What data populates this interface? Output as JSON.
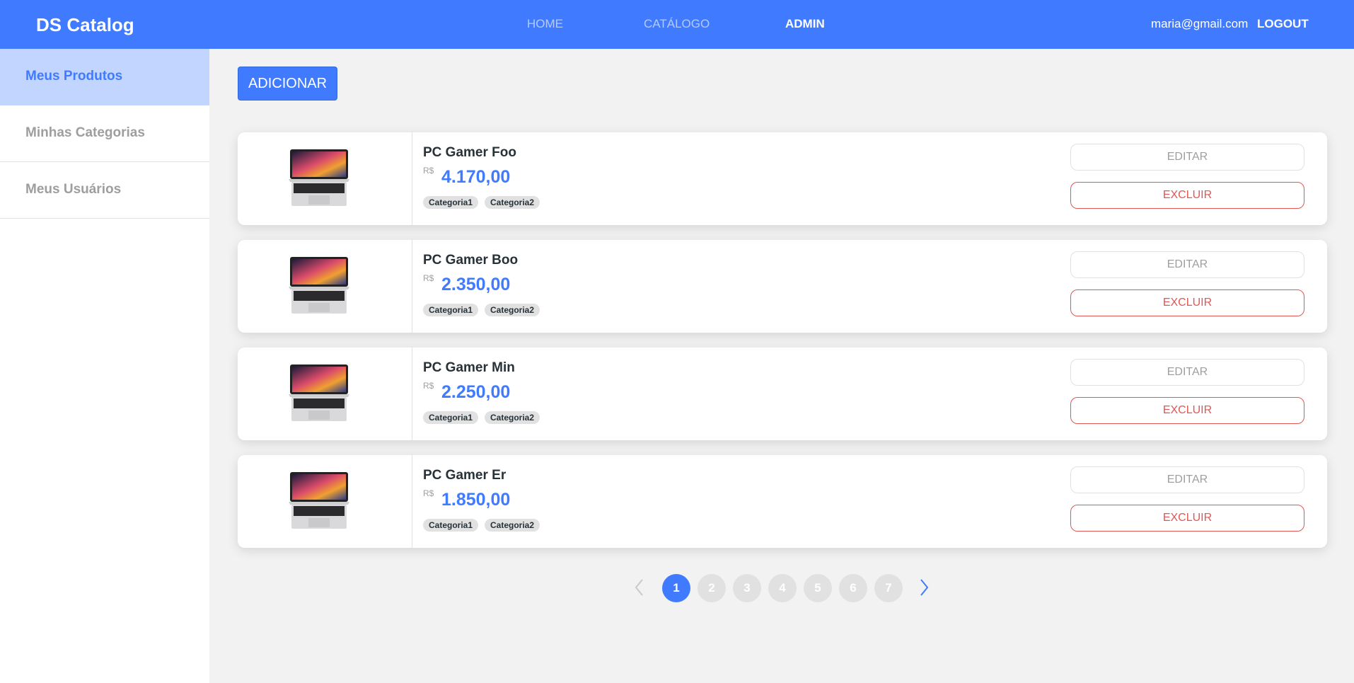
{
  "navbar": {
    "brand": "DS Catalog",
    "links": [
      {
        "label": "HOME",
        "active": false
      },
      {
        "label": "CATÁLOGO",
        "active": false
      },
      {
        "label": "ADMIN",
        "active": true
      }
    ],
    "user_email": "maria@gmail.com",
    "logout_label": "LOGOUT"
  },
  "sidebar": {
    "items": [
      {
        "label": "Meus Produtos",
        "active": true
      },
      {
        "label": "Minhas Categorias",
        "active": false
      },
      {
        "label": "Meus Usuários",
        "active": false
      }
    ]
  },
  "main": {
    "add_label": "ADICIONAR",
    "edit_label": "EDITAR",
    "delete_label": "EXCLUIR",
    "currency": "R$",
    "products": [
      {
        "name": "PC Gamer Foo",
        "price": "4.170,00",
        "categories": [
          "Categoria1",
          "Categoria2"
        ]
      },
      {
        "name": "PC Gamer Boo",
        "price": "2.350,00",
        "categories": [
          "Categoria1",
          "Categoria2"
        ]
      },
      {
        "name": "PC Gamer Min",
        "price": "2.250,00",
        "categories": [
          "Categoria1",
          "Categoria2"
        ]
      },
      {
        "name": "PC Gamer Er",
        "price": "1.850,00",
        "categories": [
          "Categoria1",
          "Categoria2"
        ]
      }
    ]
  },
  "pagination": {
    "pages": [
      "1",
      "2",
      "3",
      "4",
      "5",
      "6",
      "7"
    ],
    "current_page": "1",
    "prev_icon": "chevron-left-icon",
    "next_icon": "chevron-right-icon"
  },
  "colors": {
    "primary": "#407bff",
    "sidebar_active": "#c2d5ff",
    "danger": "#df5753",
    "muted": "#9e9e9e",
    "text_dark": "#263238"
  }
}
